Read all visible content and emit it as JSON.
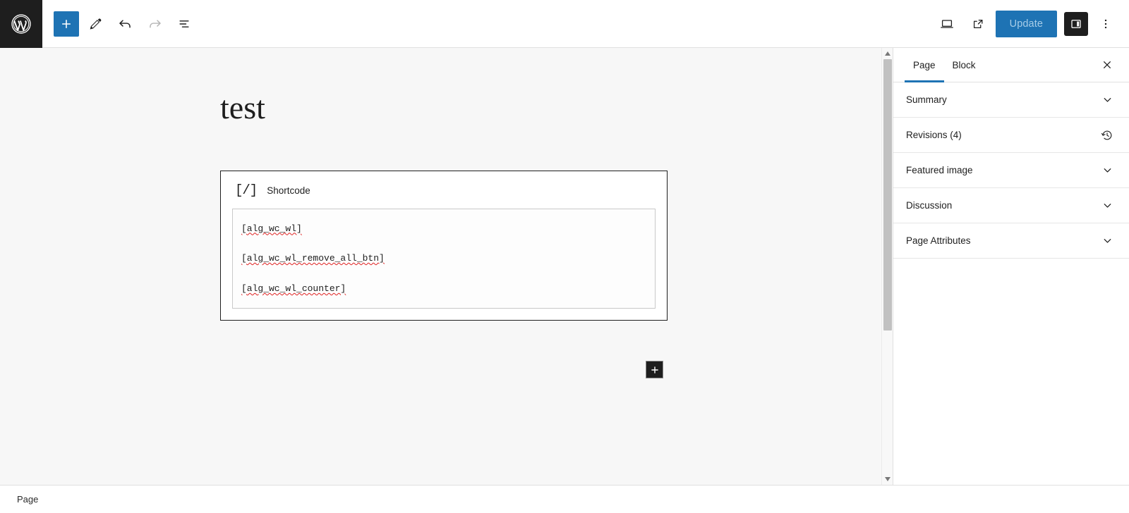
{
  "topbar": {
    "logo_icon": "wordpress-logo-icon",
    "left_tools": [
      {
        "name": "add-block-button",
        "icon": "plus-icon",
        "label": "Add block",
        "state": "primary"
      },
      {
        "name": "edit-tool-button",
        "icon": "pencil-icon",
        "label": "Tools",
        "state": "normal"
      },
      {
        "name": "undo-button",
        "icon": "undo-arrow-icon",
        "label": "Undo",
        "state": "normal"
      },
      {
        "name": "redo-button",
        "icon": "redo-arrow-icon",
        "label": "Redo",
        "state": "disabled"
      },
      {
        "name": "document-overview-button",
        "icon": "list-view-icon",
        "label": "Document Overview",
        "state": "normal"
      }
    ],
    "right_tools": [
      {
        "name": "preview-button",
        "icon": "laptop-icon",
        "label": "Preview"
      },
      {
        "name": "view-post-button",
        "icon": "external-link-icon",
        "label": "View Page"
      }
    ],
    "update_label": "Update",
    "settings_toggle_icon": "sidebar-panel-icon",
    "options_icon": "three-dots-vertical-icon",
    "accent_color": "#1e73b4"
  },
  "editor": {
    "title": "test",
    "block": {
      "icon_glyph": "[/]",
      "icon_name": "shortcode-icon",
      "label": "Shortcode",
      "lines": [
        "[alg_wc_wl]",
        "[alg_wc_wl_remove_all_btn]",
        "[alg_wc_wl_counter]"
      ],
      "spellcheck_color": "#e02020"
    },
    "add_block_inline": {
      "icon": "plus-icon",
      "label": "Add block"
    }
  },
  "sidebar": {
    "tabs": [
      {
        "label": "Page",
        "active": true
      },
      {
        "label": "Block",
        "active": false
      }
    ],
    "close_icon": "close-x-icon",
    "panels": [
      {
        "label": "Summary",
        "icon": "chevron-down-icon"
      },
      {
        "label": "Revisions (4)",
        "icon": "revision-clock-icon"
      },
      {
        "label": "Featured image",
        "icon": "chevron-down-icon"
      },
      {
        "label": "Discussion",
        "icon": "chevron-down-icon"
      },
      {
        "label": "Page Attributes",
        "icon": "chevron-down-icon"
      }
    ]
  },
  "bottombar": {
    "breadcrumb": "Page"
  }
}
